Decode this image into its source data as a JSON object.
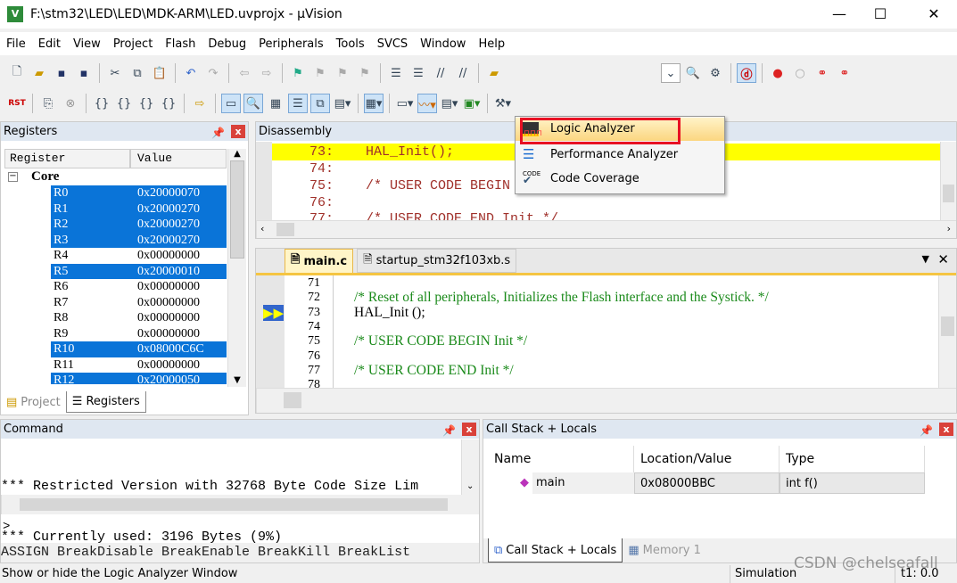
{
  "window": {
    "title": "F:\\stm32\\LED\\LED\\MDK-ARM\\LED.uvprojx - µVision",
    "logo": "V",
    "minimize": "—",
    "maximize": "☐",
    "close": "✕"
  },
  "menu": [
    "File",
    "Edit",
    "View",
    "Project",
    "Flash",
    "Debug",
    "Peripherals",
    "Tools",
    "SVCS",
    "Window",
    "Help"
  ],
  "toolbar2": {
    "reset_label": "RST"
  },
  "registers": {
    "title": "Registers",
    "col_register": "Register",
    "col_value": "Value",
    "group": "Core",
    "rows": [
      {
        "name": "R0",
        "value": "0x20000070",
        "selected": true
      },
      {
        "name": "R1",
        "value": "0x20000270",
        "selected": true
      },
      {
        "name": "R2",
        "value": "0x20000270",
        "selected": true
      },
      {
        "name": "R3",
        "value": "0x20000270",
        "selected": true
      },
      {
        "name": "R4",
        "value": "0x00000000",
        "selected": false
      },
      {
        "name": "R5",
        "value": "0x20000010",
        "selected": true
      },
      {
        "name": "R6",
        "value": "0x00000000",
        "selected": false
      },
      {
        "name": "R7",
        "value": "0x00000000",
        "selected": false
      },
      {
        "name": "R8",
        "value": "0x00000000",
        "selected": false
      },
      {
        "name": "R9",
        "value": "0x00000000",
        "selected": false
      },
      {
        "name": "R10",
        "value": "0x08000C6C",
        "selected": true
      },
      {
        "name": "R11",
        "value": "0x00000000",
        "selected": false
      },
      {
        "name": "R12",
        "value": "0x20000050",
        "selected": true
      }
    ],
    "tabs": [
      "Project",
      "Registers"
    ]
  },
  "disassembly": {
    "title": "Disassembly",
    "lines": [
      "73:    HAL_Init();",
      "74:",
      "75:    /* USER CODE BEGIN Init */",
      "76:",
      "77:    /* USER CODE END Init */"
    ]
  },
  "editor": {
    "tabs": [
      "main.c",
      "startup_stm32f103xb.s"
    ],
    "lines": [
      {
        "num": "71",
        "text": ""
      },
      {
        "num": "72",
        "text": "/* Reset of all peripherals, Initializes the Flash interface and the Systick. */",
        "comment": true
      },
      {
        "num": "73",
        "text": "HAL_Init ();",
        "comment": false
      },
      {
        "num": "74",
        "text": ""
      },
      {
        "num": "75",
        "text": "/* USER CODE BEGIN Init */",
        "comment": true
      },
      {
        "num": "76",
        "text": ""
      },
      {
        "num": "77",
        "text": "/* USER CODE END Init */",
        "comment": true
      },
      {
        "num": "78",
        "text": ""
      }
    ]
  },
  "dropdown": {
    "items": [
      "Logic Analyzer",
      "Performance Analyzer",
      "Code Coverage"
    ],
    "code_icon_text": "CODE",
    "highlight_color": "#e81123"
  },
  "command": {
    "title": "Command",
    "output": [
      "*** Restricted Version with 32768 Byte Code Size Lim",
      "*** Currently used: 3196 Bytes (9%)"
    ],
    "prompt": ">",
    "hint": "ASSIGN BreakDisable BreakEnable BreakKill BreakList"
  },
  "callstack": {
    "title": "Call Stack + Locals",
    "cols": [
      "Name",
      "Location/Value",
      "Type"
    ],
    "rows": [
      {
        "name": "main",
        "location": "0x08000BBC",
        "type": "int f()"
      }
    ],
    "tabs": [
      "Call Stack + Locals",
      "Memory 1"
    ]
  },
  "status": {
    "message": "Show or hide the Logic Analyzer Window",
    "mode": "Simulation",
    "time": "t1: 0.0",
    "watermark": "CSDN @chelseafall"
  }
}
